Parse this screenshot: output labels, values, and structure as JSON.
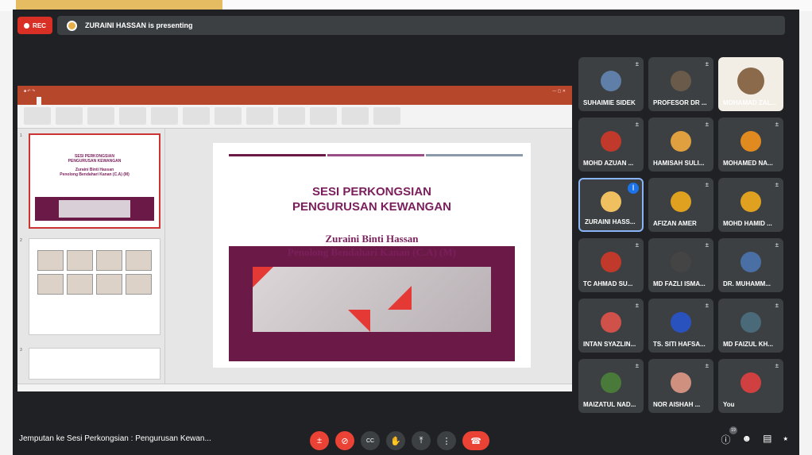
{
  "recording": {
    "label": "REC"
  },
  "presenting_banner": {
    "text": "ZURAINI HASSAN is presenting"
  },
  "slide": {
    "title_line1": "SESI PERKONGSIAN",
    "title_line2": "PENGURUSAN KEWANGAN",
    "presenter_line1": "Zuraini Binti Hassan",
    "presenter_line2": "Penolong Bendahari Kanan (C.A) (M)"
  },
  "thumbnail1": {
    "title_line1": "SESI PERKONGSIAN",
    "title_line2": "PENGURUSAN KEWANGAN",
    "sub_line1": "Zuraini Binti Hassan",
    "sub_line2": "Penolong Bendahari Kanan (C.A) (M)",
    "number": "1"
  },
  "thumbnail2": {
    "number": "2"
  },
  "thumbnail3": {
    "number": "3"
  },
  "participants": [
    {
      "name": "SUHAIMIE SIDEK",
      "muted": true,
      "color": "#5f7fa8"
    },
    {
      "name": "PROFESOR DR ...",
      "muted": true,
      "color": "#6a5a4a"
    },
    {
      "name": "MOHD AZUAN ...",
      "muted": true,
      "color": "#c0392b"
    },
    {
      "name": "HAMISAH SULI...",
      "muted": true,
      "color": "#e0a040"
    },
    {
      "name": "MOHAMED NA...",
      "muted": true,
      "color": "#e08a20"
    },
    {
      "name": "ZURAINI HASS...",
      "muted": false,
      "speaking": true,
      "color": "#f0c060"
    },
    {
      "name": "AFIZAN AMER",
      "muted": true,
      "color": "#e0a020"
    },
    {
      "name": "MOHD HAMID ...",
      "muted": true,
      "color": "#e0a020"
    },
    {
      "name": "TC AHMAD SU...",
      "muted": true,
      "color": "#c0392b"
    },
    {
      "name": "MD FAZLI ISMA...",
      "muted": true,
      "color": "#444"
    },
    {
      "name": "DR. MUHAMM...",
      "muted": true,
      "color": "#4a6fa5"
    },
    {
      "name": "INTAN SYAZLIN...",
      "muted": true,
      "color": "#d0504a"
    },
    {
      "name": "TS. SITI HAFSA...",
      "muted": true,
      "color": "#2a52be"
    },
    {
      "name": "MD FAIZUL KH...",
      "muted": true,
      "color": "#4a6a7a"
    },
    {
      "name": "MAIZATUL NAD...",
      "muted": true,
      "color": "#4a7a3a"
    },
    {
      "name": "NOR AISHAH ...",
      "muted": true,
      "color": "#d09080"
    },
    {
      "name": "You",
      "muted": true,
      "color": "#d04040"
    }
  ],
  "video_tile": {
    "name": "MOHAMAD ZAL..."
  },
  "meeting": {
    "name": "Jemputan ke Sesi Perkongsian : Pengurusan Kewan..."
  },
  "people_count": "19",
  "icons": {
    "mic_off": "±",
    "cam_off": "⊘",
    "captions": "CC",
    "hand": "✋",
    "present": "⤒",
    "more": "⋮",
    "hangup": "☎",
    "info": "ⓘ",
    "people": "☻",
    "chat": "▤",
    "activities": "⭑"
  },
  "colors": {
    "accent_red": "#ea4335",
    "meet_bg": "#202124",
    "tile_bg": "#3c4043",
    "ppt_red": "#b7472a",
    "slide_purple": "#7b1f5c"
  }
}
